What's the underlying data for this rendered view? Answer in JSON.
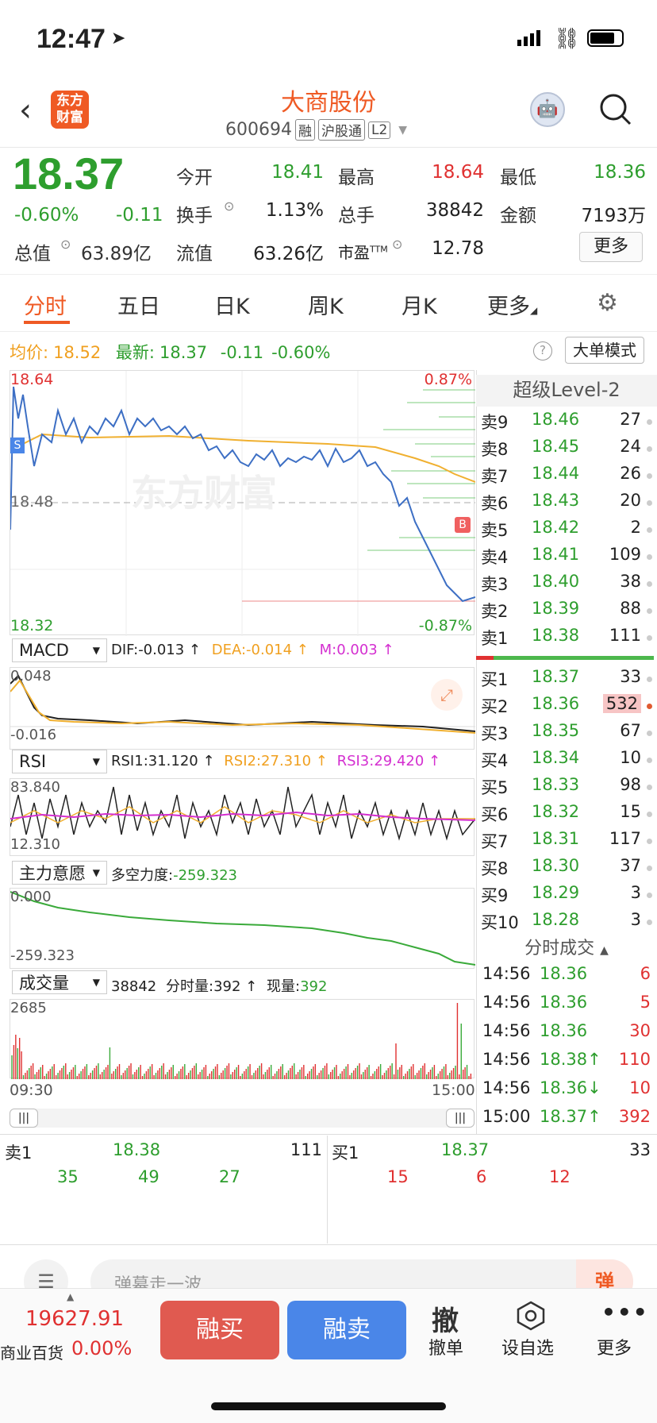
{
  "status": {
    "time": "12:47"
  },
  "header": {
    "logo": "东方财富",
    "name": "大商股份",
    "code": "600694",
    "tags": [
      "融",
      "沪股通",
      "L2"
    ]
  },
  "quote": {
    "price": "18.37",
    "pct": "-0.60%",
    "chg": "-0.11",
    "open_label": "今开",
    "open": "18.41",
    "high_label": "最高",
    "high": "18.64",
    "low_label": "最低",
    "low": "18.36",
    "turnover_label": "换手",
    "turnover": "1.13%",
    "vol_label": "总手",
    "vol": "38842",
    "amount_label": "金额",
    "amount": "7193万",
    "mcap_label": "总值",
    "mcap": "63.89亿",
    "float_label": "流值",
    "float": "63.26亿",
    "pe_label": "市盈",
    "pe_sup": "TTM",
    "pe": "12.78",
    "more": "更多"
  },
  "tabs": [
    "分时",
    "五日",
    "日K",
    "周K",
    "月K",
    "更多"
  ],
  "avgline": {
    "avg_label": "均价:",
    "avg": "18.52",
    "new_label": "最新:",
    "new": "18.37",
    "chg": "-0.11",
    "pct": "-0.60%",
    "mode": "大单模式"
  },
  "chart": {
    "high": "18.64",
    "low": "18.32",
    "mid": "18.48",
    "pct_up": "0.87%",
    "pct_down": "-0.87%",
    "watermark": "东方财富",
    "buy_marker": "B",
    "sell_marker": "S",
    "start": "09:30",
    "end": "15:00"
  },
  "macd": {
    "name": "MACD",
    "dif": "DIF:-0.013 ↑",
    "dea": "DEA:-0.014 ↑",
    "m": "M:0.003 ↑",
    "top": "0.048",
    "bottom": "-0.016"
  },
  "rsi": {
    "name": "RSI",
    "rsi1": "RSI1:31.120 ↑",
    "rsi2": "RSI2:27.310 ↑",
    "rsi3": "RSI3:29.420 ↑",
    "top": "83.840",
    "bottom": "12.310"
  },
  "zl": {
    "name": "主力意愿",
    "label": "多空力度:",
    "value": "-259.323",
    "top": "0.000",
    "bottom": "-259.323"
  },
  "volume": {
    "name": "成交量",
    "total": "38842",
    "fs_label": "分时量:",
    "fs": "392 ↑",
    "now_label": "现量:",
    "now": "392",
    "top": "2685"
  },
  "level2": {
    "title": "超级Level-2",
    "asks": [
      {
        "l": "卖9",
        "p": "18.46",
        "v": "27"
      },
      {
        "l": "卖8",
        "p": "18.45",
        "v": "24"
      },
      {
        "l": "卖7",
        "p": "18.44",
        "v": "26"
      },
      {
        "l": "卖6",
        "p": "18.43",
        "v": "20"
      },
      {
        "l": "卖5",
        "p": "18.42",
        "v": "2"
      },
      {
        "l": "卖4",
        "p": "18.41",
        "v": "109"
      },
      {
        "l": "卖3",
        "p": "18.40",
        "v": "38"
      },
      {
        "l": "卖2",
        "p": "18.39",
        "v": "88"
      },
      {
        "l": "卖1",
        "p": "18.38",
        "v": "111"
      }
    ],
    "bids": [
      {
        "l": "买1",
        "p": "18.37",
        "v": "33"
      },
      {
        "l": "买2",
        "p": "18.36",
        "v": "532"
      },
      {
        "l": "买3",
        "p": "18.35",
        "v": "67"
      },
      {
        "l": "买4",
        "p": "18.34",
        "v": "10"
      },
      {
        "l": "买5",
        "p": "18.33",
        "v": "98"
      },
      {
        "l": "买6",
        "p": "18.32",
        "v": "15"
      },
      {
        "l": "买7",
        "p": "18.31",
        "v": "117"
      },
      {
        "l": "买8",
        "p": "18.30",
        "v": "37"
      },
      {
        "l": "买9",
        "p": "18.29",
        "v": "3"
      },
      {
        "l": "买10",
        "p": "18.28",
        "v": "3"
      }
    ],
    "trades_title": "分时成交",
    "trades": [
      {
        "t": "14:56",
        "p": "18.36",
        "v": "6"
      },
      {
        "t": "14:56",
        "p": "18.36",
        "v": "5"
      },
      {
        "t": "14:56",
        "p": "18.36",
        "v": "30"
      },
      {
        "t": "14:56",
        "p": "18.38↑",
        "v": "110"
      },
      {
        "t": "14:56",
        "p": "18.36↓",
        "v": "10"
      },
      {
        "t": "15:00",
        "p": "18.37↑",
        "v": "392"
      }
    ]
  },
  "queue": {
    "sell_label": "卖1",
    "sell_price": "18.38",
    "sell_vol": "111",
    "sell_q": [
      "35",
      "49",
      "27"
    ],
    "buy_label": "买1",
    "buy_price": "18.37",
    "buy_vol": "33",
    "buy_q": [
      "15",
      "6",
      "12"
    ]
  },
  "danmu": {
    "placeholder": "弹幕走一波...",
    "btn": "弹"
  },
  "bottom": {
    "index": "19627.91",
    "index_name": "商业百货",
    "index_pct": "0.00%",
    "buy": "融买",
    "sell": "融卖",
    "cancel_icon": "撤",
    "cancel": "撤单",
    "watch": "设自选",
    "more": "更多"
  },
  "colors": {
    "accent": "#ef5a24",
    "up": "#e03131",
    "down": "#2e9e2e",
    "buy_btn": "#e05a50",
    "sell_btn": "#4a86e8"
  }
}
